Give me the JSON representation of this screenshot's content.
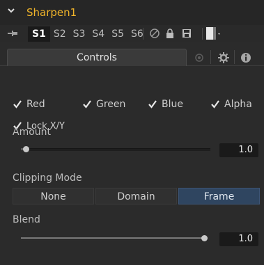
{
  "tool": {
    "name": "Sharpen1"
  },
  "versions": {
    "tabs": [
      "S1",
      "S2",
      "S3",
      "S4",
      "S5",
      "S6"
    ],
    "active": "S1"
  },
  "tabs": {
    "controls_label": "Controls",
    "icons": [
      "modifiers-icon",
      "settings-gear-icon",
      "info-icon"
    ]
  },
  "channels": {
    "red": {
      "label": "Red",
      "checked": true
    },
    "green": {
      "label": "Green",
      "checked": true
    },
    "blue": {
      "label": "Blue",
      "checked": true
    },
    "alpha": {
      "label": "Alpha",
      "checked": true
    }
  },
  "lock_xy": {
    "label": "Lock X/Y",
    "checked": true
  },
  "amount": {
    "label": "Amount",
    "value": "1.0",
    "level": 0.0
  },
  "clipping": {
    "label": "Clipping Mode",
    "options": [
      "None",
      "Domain",
      "Frame"
    ],
    "selected": "Frame"
  },
  "blend": {
    "label": "Blend",
    "value": "1.0",
    "level": 1.0
  },
  "colors": {
    "tool_name": "#f0b42a",
    "selected_segment": "#2f4560",
    "background": "#2b2b2b"
  }
}
